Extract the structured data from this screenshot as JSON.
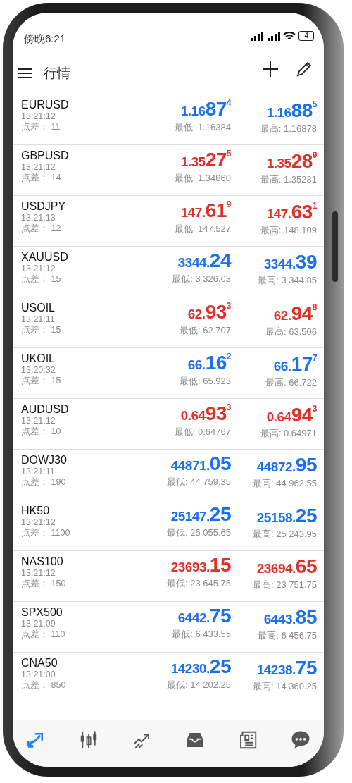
{
  "status_bar": {
    "time": "傍晚6:21",
    "battery": "4"
  },
  "header": {
    "title": "行情"
  },
  "quotes": [
    {
      "symbol": "EURUSD",
      "time": "13:21:12",
      "spread": "点差： 11",
      "bid": {
        "pre": "1.16",
        "big": "87",
        "sup": "4",
        "color": "#1a6ff0"
      },
      "ask": {
        "pre": "1.16",
        "big": "88",
        "sup": "5",
        "color": "#1a6ff0"
      },
      "low": "最低: 1.16384",
      "high": "最高: 1.16878"
    },
    {
      "symbol": "GBPUSD",
      "time": "13:21:12",
      "spread": "点差： 14",
      "bid": {
        "pre": "1.35",
        "big": "27",
        "sup": "5",
        "color": "#e0302a"
      },
      "ask": {
        "pre": "1.35",
        "big": "28",
        "sup": "9",
        "color": "#e0302a"
      },
      "low": "最低: 1.34860",
      "high": "最高: 1.35281"
    },
    {
      "symbol": "USDJPY",
      "time": "13:21:13",
      "spread": "点差： 12",
      "bid": {
        "pre": "147.",
        "big": "61",
        "sup": "9",
        "color": "#e0302a"
      },
      "ask": {
        "pre": "147.",
        "big": "63",
        "sup": "1",
        "color": "#e0302a"
      },
      "low": "最低: 147.527",
      "high": "最高: 148.109"
    },
    {
      "symbol": "XAUUSD",
      "time": "13:21:12",
      "spread": "点差： 15",
      "bid": {
        "pre": "3344.",
        "big": "24",
        "color": "#1a6ff0"
      },
      "ask": {
        "pre": "3344.",
        "big": "39",
        "color": "#1a6ff0"
      },
      "low": "最低: 3 326.03",
      "high": "最高: 3 344.85"
    },
    {
      "symbol": "USOIL",
      "time": "13:21:11",
      "spread": "点差： 15",
      "bid": {
        "pre": "62.",
        "big": "93",
        "sup": "3",
        "color": "#e0302a"
      },
      "ask": {
        "pre": "62.",
        "big": "94",
        "sup": "8",
        "color": "#e0302a"
      },
      "low": "最低: 62.707",
      "high": "最高: 63.506"
    },
    {
      "symbol": "UKOIL",
      "time": "13:20:32",
      "spread": "点差： 15",
      "bid": {
        "pre": "66.",
        "big": "16",
        "sup": "2",
        "color": "#1a6ff0"
      },
      "ask": {
        "pre": "66.",
        "big": "17",
        "sup": "7",
        "color": "#1a6ff0"
      },
      "low": "最低: 65.923",
      "high": "最高: 66.722"
    },
    {
      "symbol": "AUDUSD",
      "time": "13:21:12",
      "spread": "点差： 10",
      "bid": {
        "pre": "0.64",
        "big": "93",
        "sup": "3",
        "color": "#e0302a"
      },
      "ask": {
        "pre": "0.64",
        "big": "94",
        "sup": "3",
        "color": "#e0302a"
      },
      "low": "最低: 0.64767",
      "high": "最高: 0.64971"
    },
    {
      "symbol": "DOWJ30",
      "time": "13:21:11",
      "spread": "点差： 190",
      "bid": {
        "pre": "44871.",
        "big": "05",
        "color": "#1a6ff0"
      },
      "ask": {
        "pre": "44872.",
        "big": "95",
        "color": "#1a6ff0"
      },
      "low": "最低: 44 759.35",
      "high": "最高: 44 962.55"
    },
    {
      "symbol": "HK50",
      "time": "13:21:12",
      "spread": "点差： 1100",
      "bid": {
        "pre": "25147.",
        "big": "25",
        "color": "#1a6ff0"
      },
      "ask": {
        "pre": "25158.",
        "big": "25",
        "color": "#1a6ff0"
      },
      "low": "最低: 25 055.65",
      "high": "最高: 25 243.95"
    },
    {
      "symbol": "NAS100",
      "time": "13:21:12",
      "spread": "点差： 150",
      "bid": {
        "pre": "23693.",
        "big": "15",
        "color": "#e0302a"
      },
      "ask": {
        "pre": "23694.",
        "big": "65",
        "color": "#e0302a"
      },
      "low": "最低: 23 645.75",
      "high": "最高: 23 751.75"
    },
    {
      "symbol": "SPX500",
      "time": "13:21:09",
      "spread": "点差： 110",
      "bid": {
        "pre": "6442.",
        "big": "75",
        "color": "#1a6ff0"
      },
      "ask": {
        "pre": "6443.",
        "big": "85",
        "color": "#1a6ff0"
      },
      "low": "最低: 6 433.55",
      "high": "最高: 6 456.75"
    },
    {
      "symbol": "CNA50",
      "time": "13:21:00",
      "spread": "点差： 850",
      "bid": {
        "pre": "14230.",
        "big": "25",
        "color": "#1a6ff0"
      },
      "ask": {
        "pre": "14238.",
        "big": "75",
        "color": "#1a6ff0"
      },
      "low": "最低: 14 202.25",
      "high": "最高: 14 360.25"
    }
  ],
  "tabs": [
    {
      "kind": "quotes",
      "selected": true
    },
    {
      "kind": "chart",
      "selected": false
    },
    {
      "kind": "trade",
      "selected": false
    },
    {
      "kind": "history",
      "selected": false
    },
    {
      "kind": "news",
      "selected": false
    },
    {
      "kind": "chat",
      "selected": false
    }
  ]
}
